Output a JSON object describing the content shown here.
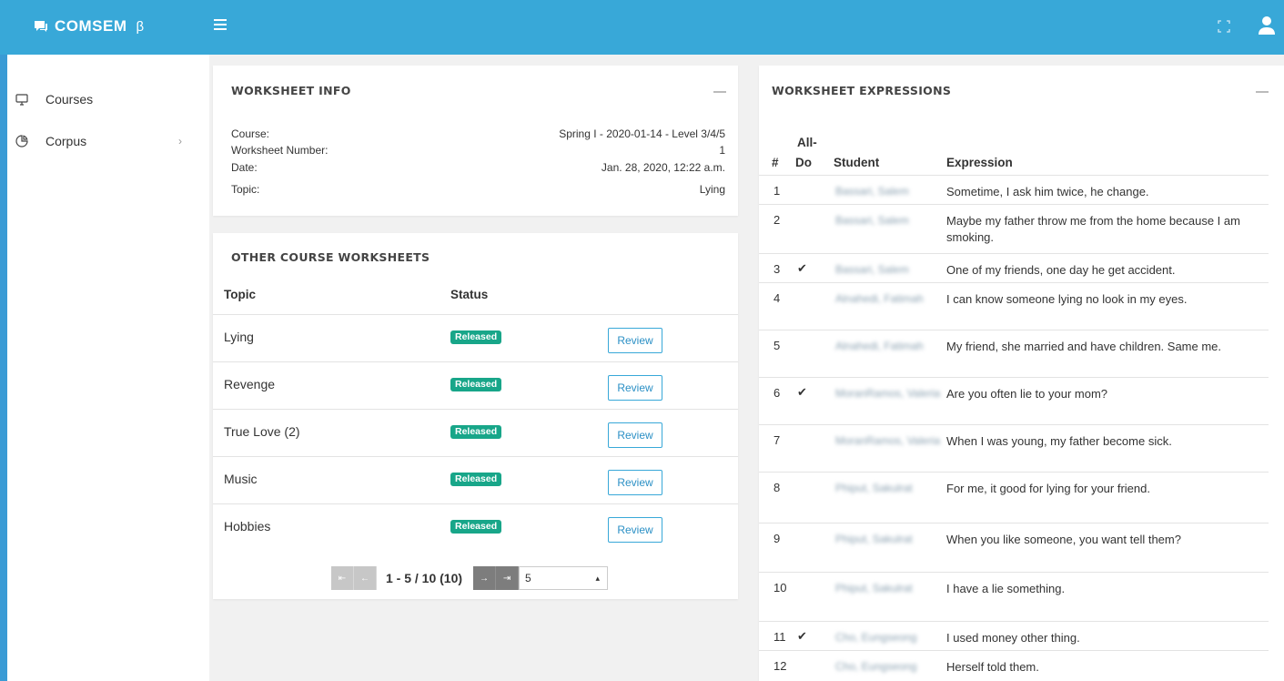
{
  "brand": {
    "name": "COMSEM",
    "beta": "β"
  },
  "sidebar": {
    "items": [
      {
        "label": "Courses"
      },
      {
        "label": "Corpus"
      }
    ]
  },
  "worksheet_info": {
    "title": "WORKSHEET INFO",
    "rows": [
      {
        "label": "Course:",
        "value": "Spring I - 2020-01-14 - Level 3/4/5"
      },
      {
        "label": "Worksheet Number:",
        "value": "1"
      },
      {
        "label": "Date:",
        "value": "Jan. 28, 2020, 12:22 a.m."
      },
      {
        "label": "Topic:",
        "value": "Lying"
      }
    ]
  },
  "other_worksheets": {
    "title": "OTHER COURSE WORKSHEETS",
    "headers": {
      "topic": "Topic",
      "status": "Status"
    },
    "rows": [
      {
        "topic": "Lying",
        "status": "Released",
        "action": "Review"
      },
      {
        "topic": "Revenge",
        "status": "Released",
        "action": "Review"
      },
      {
        "topic": "True Love (2)",
        "status": "Released",
        "action": "Review"
      },
      {
        "topic": "Music",
        "status": "Released",
        "action": "Review"
      },
      {
        "topic": "Hobbies",
        "status": "Released",
        "action": "Review"
      }
    ],
    "pagination": {
      "info": "1 - 5 / 10 (10)",
      "page_size": "5"
    }
  },
  "expressions": {
    "title": "WORKSHEET EXPRESSIONS",
    "headers": {
      "num": "#",
      "all_do_line1": "All-",
      "all_do_line2": "Do",
      "student": "Student",
      "expression": "Expression"
    },
    "rows": [
      {
        "num": "1",
        "check": "",
        "student": "Bassari, Salem",
        "expression": "Sometime, I ask him twice, he change."
      },
      {
        "num": "2",
        "check": "",
        "student": "Bassari, Salem",
        "expression": "Maybe my father throw me from the home because I am smoking."
      },
      {
        "num": "3",
        "check": "✔",
        "student": "Bassari, Salem",
        "expression": "One of my friends, one day he get accident."
      },
      {
        "num": "4",
        "check": "",
        "student": "Alnahedi, Fatimah",
        "expression": "I can know someone lying no look in my eyes."
      },
      {
        "num": "5",
        "check": "",
        "student": "Alnahedi, Fatimah",
        "expression": "My friend, she married and have children. Same me."
      },
      {
        "num": "6",
        "check": "✔",
        "student": "MoranRamos, Valeria",
        "expression": "Are you often lie to your mom?"
      },
      {
        "num": "7",
        "check": "",
        "student": "MoranRamos, Valeria",
        "expression": "When I was young, my father become sick."
      },
      {
        "num": "8",
        "check": "",
        "student": "Phiput, Sakulrat",
        "expression": "For me, it good for lying for your friend."
      },
      {
        "num": "9",
        "check": "",
        "student": "Phiput, Sakulrat",
        "expression": "When you like someone, you want tell them?"
      },
      {
        "num": "10",
        "check": "",
        "student": "Phiput, Sakulrat",
        "expression": "I have a lie something."
      },
      {
        "num": "11",
        "check": "✔",
        "student": "Cho, Eungseong",
        "expression": "I used money other thing."
      },
      {
        "num": "12",
        "check": "",
        "student": "Cho, Eungseong",
        "expression": "Herself told them."
      }
    ]
  },
  "colors": {
    "header": "#38a8d8",
    "badge": "#18a689",
    "frame": "#3a9bd5"
  }
}
